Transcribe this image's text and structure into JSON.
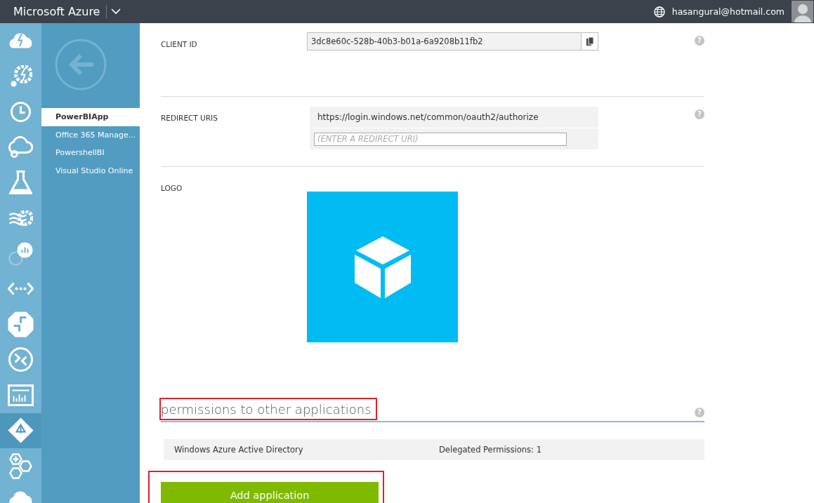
{
  "topbar": {
    "brand": "Microsoft Azure",
    "account": "hasangural@hotmail.com"
  },
  "rail": {
    "items": [
      {
        "kind": "cloud-bolt",
        "selected": false
      },
      {
        "kind": "gear-bolt",
        "selected": false
      },
      {
        "kind": "clock",
        "selected": false
      },
      {
        "kind": "cloud-link",
        "selected": false
      },
      {
        "kind": "flask",
        "selected": false
      },
      {
        "kind": "wave-gear",
        "selected": false
      },
      {
        "kind": "chart-bubble",
        "selected": false
      },
      {
        "kind": "code-dots",
        "selected": false
      },
      {
        "kind": "arrows",
        "selected": false
      },
      {
        "kind": "circle-arrows",
        "selected": false
      },
      {
        "kind": "dashboard",
        "selected": false
      },
      {
        "kind": "diamond",
        "selected": true
      },
      {
        "kind": "hexagons",
        "selected": false
      },
      {
        "kind": "cloud-list",
        "selected": false
      }
    ]
  },
  "subnav": {
    "items": [
      {
        "label": "PowerBIApp",
        "selected": true
      },
      {
        "label": "Office 365 Manage...",
        "selected": false
      },
      {
        "label": "PowershellBI",
        "selected": false
      },
      {
        "label": "Visual Studio Online",
        "selected": false
      }
    ]
  },
  "fields": [
    {
      "kind": "readonly",
      "label": "CLIENT ID",
      "value": "3dc8e60c-528b-40b3-b01a-6a9208b11fb2",
      "help": "?"
    },
    {
      "kind": "uris",
      "label": "REDIRECT URIS",
      "value": "https://login.windows.net/common/oauth2/authorize",
      "placeholder": "(ENTER A REDIRECT URI)",
      "help": "?"
    },
    {
      "kind": "logo",
      "label": "LOGO"
    }
  ],
  "permissions": {
    "heading": "permissions to other applications",
    "highlighted": true,
    "help": "?",
    "rows": [
      {
        "application": "Windows Azure Active Directory",
        "permissions": "Delegated Permissions: 1"
      }
    ],
    "button": {
      "label": "Add application",
      "highlighted": true
    }
  }
}
